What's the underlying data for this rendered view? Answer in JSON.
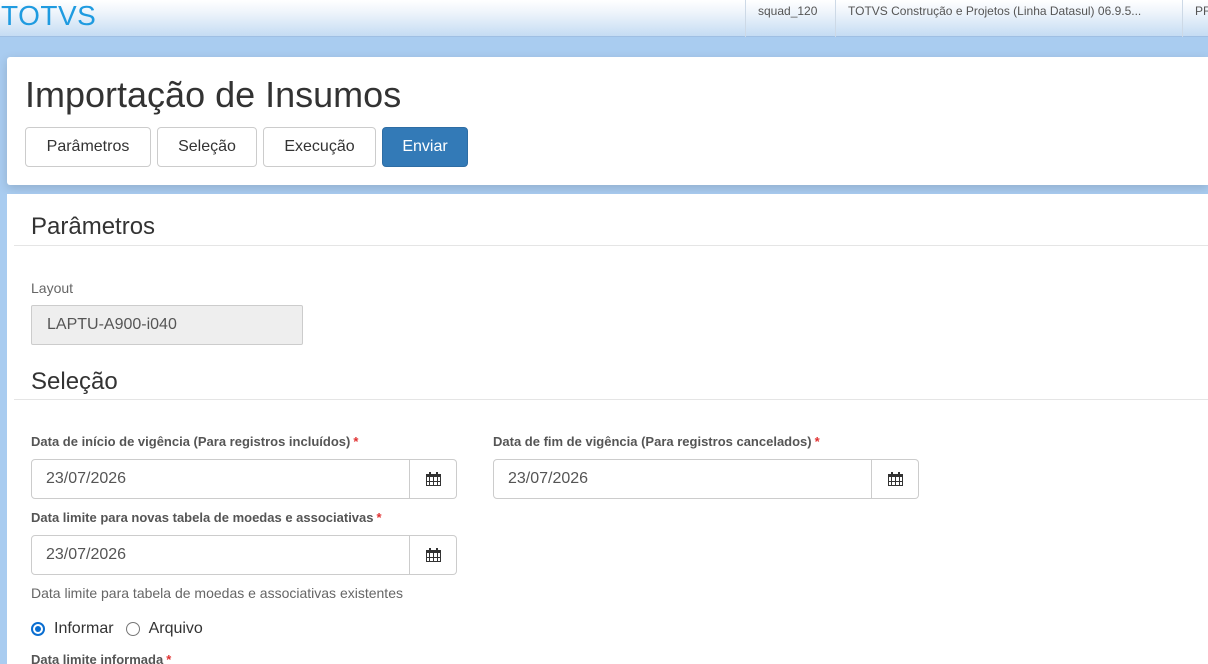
{
  "topbar": {
    "brand": "TOTVS",
    "user": "squad_120",
    "product": "TOTVS Construção e Projetos (Linha Datasul) 06.9.5...",
    "extra": "PF"
  },
  "header": {
    "title": "Importação de Insumos",
    "buttons": {
      "parametros": "Parâmetros",
      "selecao": "Seleção",
      "execucao": "Execução",
      "enviar": "Enviar"
    }
  },
  "parametros": {
    "title": "Parâmetros",
    "layout_label": "Layout",
    "layout_value": "LAPTU-A900-i040"
  },
  "selecao": {
    "title": "Seleção",
    "inicio_label": "Data de início de vigência (Para registros incluídos)",
    "inicio_value": "23/07/2026",
    "fim_label": "Data de fim de vigência (Para registros cancelados)",
    "fim_value": "23/07/2026",
    "limite_label": "Data limite para novas tabela de moedas e associativas",
    "limite_value": "23/07/2026",
    "existentes_label": "Data limite para tabela de moedas e associativas existentes",
    "radio_informar": "Informar",
    "radio_arquivo": "Arquivo",
    "informada_label": "Data limite informada",
    "required_mark": "*"
  },
  "colors": {
    "brand": "#1f9be0",
    "primary_button": "#337ab7",
    "required": "#e03030",
    "radio_selected": "#0a6ed1"
  },
  "icons": {
    "calendar": "calendar-icon"
  }
}
